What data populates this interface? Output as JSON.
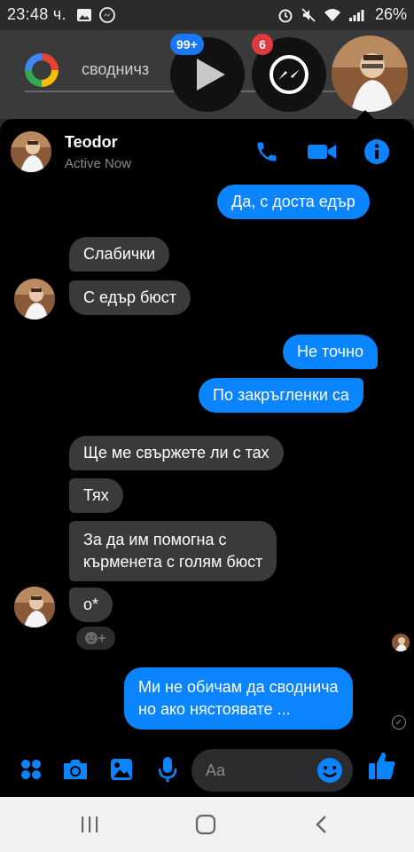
{
  "status_bar": {
    "time": "23:48 ч.",
    "battery": "26%"
  },
  "launcher": {
    "search_query": "сводничз"
  },
  "chat_heads": {
    "play_badge": "99+",
    "messenger_badge": "6"
  },
  "conversation": {
    "contact_name": "Teodor",
    "contact_status": "Active Now",
    "messages": [
      {
        "dir": "out",
        "text": "Да, с доста едър"
      },
      {
        "dir": "in",
        "text": "Слабички"
      },
      {
        "dir": "in",
        "text": "С едър бюст"
      },
      {
        "dir": "out",
        "text": "Не точно"
      },
      {
        "dir": "out",
        "text": "По закръгленки са"
      },
      {
        "dir": "in",
        "text": "Ще ме свържете ли с тах"
      },
      {
        "dir": "in",
        "text": "Тях"
      },
      {
        "dir": "in",
        "text": "За да им помогна с"
      },
      {
        "dir": "in",
        "text": "кърменета с голям бюст"
      },
      {
        "dir": "in",
        "text": "о*"
      },
      {
        "dir": "out",
        "text": "Ми не обичам да сводничa"
      },
      {
        "dir": "out",
        "text": "но ако нястоявате ..."
      }
    ]
  },
  "composer": {
    "placeholder": "Aa"
  },
  "colors": {
    "accent": "#0a84ff",
    "incoming_bubble": "#3a3a3c",
    "panel_bg": "#000000"
  },
  "icons": [
    "google-logo",
    "play-icon",
    "messenger-icon",
    "phone-icon",
    "video-icon",
    "info-icon",
    "apps-icon",
    "camera-icon",
    "gallery-icon",
    "mic-icon",
    "emoji-icon",
    "like-icon",
    "recent-apps-icon",
    "home-icon",
    "back-icon"
  ]
}
